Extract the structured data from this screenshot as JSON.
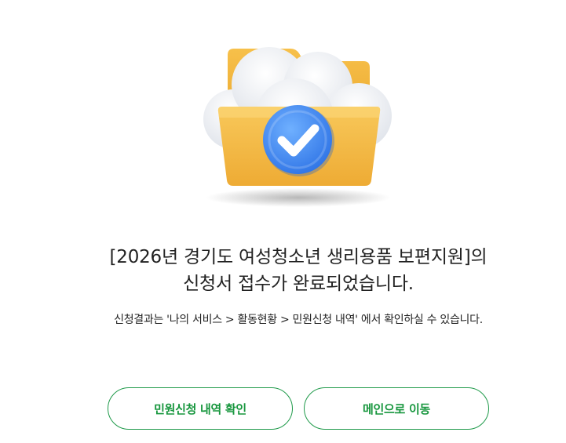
{
  "result": {
    "title_line1": "[2026년 경기도 여성청소년 생리용품 보편지원]의",
    "title_line2": "신청서 접수가 완료되었습니다.",
    "description": "신청결과는 '나의 서비스 > 활동현황 > 민원신청 내역' 에서 확인하실 수 있습니다."
  },
  "buttons": {
    "history_label": "민원신청 내역 확인",
    "main_label": "메인으로 이동"
  },
  "illustration": {
    "icon": "folder-cloud-check-icon"
  },
  "colors": {
    "accent_green": "#16963d",
    "folder_yellow": "#f3b83d",
    "check_blue": "#3a86f0"
  }
}
